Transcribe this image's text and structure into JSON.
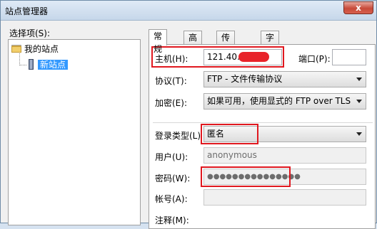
{
  "window": {
    "title": "站点管理器",
    "close_glyph": "x"
  },
  "sidebar": {
    "label": "选择项(S):",
    "tree": [
      {
        "label": "我的站点",
        "icon": "folder-icon"
      },
      {
        "label": "新站点",
        "icon": "server-icon",
        "selected": true
      }
    ]
  },
  "tabs": [
    {
      "label": "常规",
      "active": true
    },
    {
      "label": "高级"
    },
    {
      "label": "传输设置"
    },
    {
      "label": "字符集"
    }
  ],
  "form": {
    "host_label": "主机(H):",
    "host_value": "121.40.",
    "port_label": "端口(P):",
    "port_value": "",
    "protocol_label": "协议(T):",
    "protocol_value": "FTP - 文件传输协议",
    "encryption_label": "加密(E):",
    "encryption_value": "如果可用，使用显式的 FTP over TLS",
    "logon_label": "登录类型(L)",
    "logon_value": "匿名",
    "user_label": "用户(U):",
    "user_value": "anonymous",
    "password_label": "密码(W):",
    "password_value": "●●●●●●●●●●●●●●●",
    "account_label": "帐号(A):",
    "account_value": "",
    "comments_label": "注释(M):"
  },
  "colors": {
    "highlight": "#e0181f",
    "selection": "#3399ff"
  }
}
